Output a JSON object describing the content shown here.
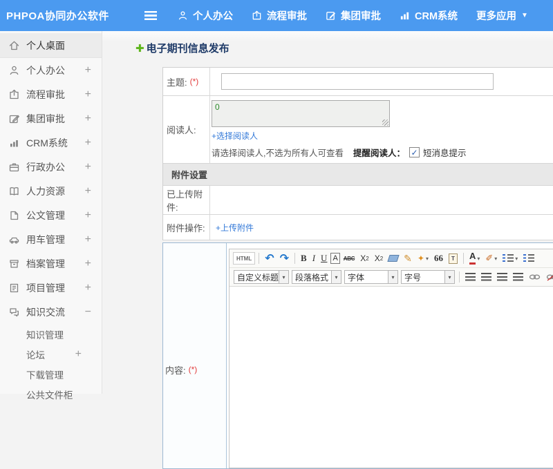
{
  "topbar": {
    "logo": "PHPOA协同办公软件",
    "nav": [
      {
        "label": "个人办公"
      },
      {
        "label": "流程审批"
      },
      {
        "label": "集团审批"
      },
      {
        "label": "CRM系统"
      },
      {
        "label": "更多应用"
      }
    ]
  },
  "sidebar": {
    "items": [
      {
        "label": "个人桌面",
        "expand": ""
      },
      {
        "label": "个人办公",
        "expand": "+"
      },
      {
        "label": "流程审批",
        "expand": "+"
      },
      {
        "label": "集团审批",
        "expand": "+"
      },
      {
        "label": "CRM系统",
        "expand": "+"
      },
      {
        "label": "行政办公",
        "expand": "+"
      },
      {
        "label": "人力资源",
        "expand": "+"
      },
      {
        "label": "公文管理",
        "expand": "+"
      },
      {
        "label": "用车管理",
        "expand": "+"
      },
      {
        "label": "档案管理",
        "expand": "+"
      },
      {
        "label": "项目管理",
        "expand": "+"
      },
      {
        "label": "知识交流",
        "expand": "−"
      },
      {
        "label": "知识管理",
        "expand": ""
      },
      {
        "label": "论坛",
        "expand": "+"
      },
      {
        "label": "下载管理",
        "expand": ""
      },
      {
        "label": "公共文件柜",
        "expand": ""
      }
    ]
  },
  "main": {
    "page_title": "电子期刊信息发布",
    "form": {
      "subject_label": "主题:",
      "required": "(*)",
      "readers_label": "阅读人:",
      "readers_value": "0",
      "select_readers_link": "+选择阅读人",
      "readers_hint": "请选择阅读人,不选为所有人可查看",
      "remind_readers_label": "提醒阅读人：",
      "sms_checkbox_label": "短消息提示",
      "sms_checked": "true",
      "attachment_section_title": "附件设置",
      "uploaded_label": "已上传附件:",
      "operation_label": "附件操作:",
      "upload_link": "+上传附件",
      "content_label": "内容:"
    },
    "editor": {
      "buttons": {
        "html": "HTML",
        "bold": "B",
        "italic": "I",
        "underline": "U",
        "boxed_a": "A",
        "strike": "ABC",
        "script_base": "X",
        "script_mark": "2",
        "quote": "66",
        "paste": "T",
        "fontcolor": "A"
      },
      "selects": {
        "heading": "自定义标题",
        "paragraph": "段落格式",
        "fontname": "字体",
        "fontsize": "字号"
      }
    }
  },
  "icons": {
    "caret_down": "▾",
    "caret_down_big": "▼",
    "green_plus": "✚",
    "undo": "↶",
    "redo": "↷",
    "brush": "✎",
    "wand": "✦",
    "highlight": "✐",
    "check": "✓"
  },
  "colors": {
    "topbar_blue": "#4b9af0",
    "link_blue": "#3379d8",
    "title_navy": "#1f3b68",
    "required_red": "#e23b3b",
    "readers_green": "#2c8a2c"
  }
}
